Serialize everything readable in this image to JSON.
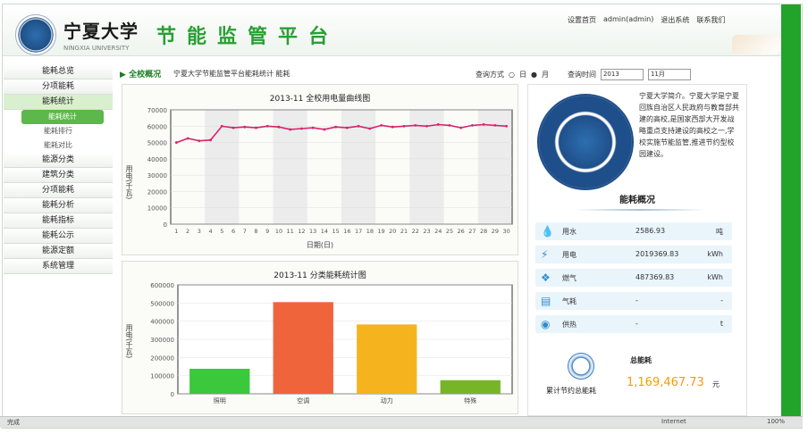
{
  "header": {
    "school_name": "宁夏大学",
    "school_sub": "NINGXIA UNIVERSITY",
    "system_title": "节能监管平台",
    "nav": [
      "设置首页",
      "admin(admin)",
      "退出系统",
      "联系我们"
    ]
  },
  "sidebar": {
    "items": [
      {
        "label": "能耗总览"
      },
      {
        "label": "分项能耗"
      },
      {
        "label": "能耗统计",
        "active": true,
        "sub": [
          {
            "label": "能耗统计",
            "active": true
          },
          {
            "label": "能耗排行"
          },
          {
            "label": "能耗对比"
          }
        ]
      },
      {
        "label": "能源分类"
      },
      {
        "label": "建筑分类"
      },
      {
        "label": "分项能耗"
      },
      {
        "label": "能耗分析"
      },
      {
        "label": "能耗指标"
      },
      {
        "label": "能耗公示"
      },
      {
        "label": "能源定额"
      },
      {
        "label": "系统管理"
      }
    ]
  },
  "breadcrumb": {
    "title": "全校概况",
    "text": "宁夏大学节能监管平台能耗统计 能耗"
  },
  "filters": {
    "label1": "查询方式",
    "opt1": "日",
    "opt2": "月",
    "label2": "查询时间",
    "year": "2013",
    "month": "11月"
  },
  "line_panel": {
    "title": "2013-11 全校用电量曲线图",
    "ylabel": "用电(千瓦)",
    "xlabel": "日期(日)"
  },
  "bar_panel": {
    "title": "2013-11 分类能耗统计图",
    "ylabel": "用电(千瓦)"
  },
  "info": {
    "emblem_text": "NINGXIA UNIVERSITY",
    "intro": "宁夏大学简介。宁夏大学是宁夏回族自治区人民政府与教育部共建的高校,是国家西部大开发战略重点支持建设的高校之一,学校实施节能监管,推进节约型校园建设。",
    "stats_title": "能耗概况",
    "stats": [
      {
        "icon": "droplet-icon",
        "glyph": "💧",
        "name": "用水",
        "value": "2586.93",
        "unit": "吨"
      },
      {
        "icon": "bolt-icon",
        "glyph": "⚡",
        "name": "用电",
        "value": "2019369.83",
        "unit": "kWh"
      },
      {
        "icon": "share-icon",
        "glyph": "❖",
        "name": "燃气",
        "value": "487369.83",
        "unit": "kWh"
      },
      {
        "icon": "flame-icon",
        "glyph": "▤",
        "name": "气耗",
        "value": "-",
        "unit": "-"
      },
      {
        "icon": "heat-icon",
        "glyph": "◉",
        "name": "供热",
        "value": "-",
        "unit": "t"
      }
    ],
    "total_label": "总能耗",
    "total_caption": "累计节约总能耗",
    "total_value": "1,169,467.73",
    "total_unit": "元"
  },
  "taskbar": {
    "left": "完成",
    "right1": "Internet",
    "zoom": "100%"
  },
  "chart_data": [
    {
      "type": "line",
      "title": "2013-11 全校用电量曲线图",
      "xlabel": "日期(日)",
      "ylabel": "用电(千瓦)",
      "x": [
        1,
        2,
        3,
        4,
        5,
        6,
        7,
        8,
        9,
        10,
        11,
        12,
        13,
        14,
        15,
        16,
        17,
        18,
        19,
        20,
        21,
        22,
        23,
        24,
        25,
        26,
        27,
        28,
        29,
        30
      ],
      "values": [
        50000,
        52500,
        51000,
        51500,
        60000,
        59000,
        59500,
        59000,
        60000,
        59500,
        58000,
        58500,
        59000,
        58000,
        59500,
        59000,
        60000,
        58500,
        60500,
        59500,
        60000,
        60500,
        60000,
        61000,
        60500,
        59000,
        60500,
        61000,
        60500,
        60000
      ],
      "ylim": [
        0,
        70000
      ],
      "color": "#d6246c"
    },
    {
      "type": "bar",
      "title": "2013-11 分类能耗统计图",
      "ylabel": "用电(千瓦)",
      "categories": [
        "照明",
        "空调",
        "动力",
        "特殊"
      ],
      "values": [
        138000,
        505000,
        382000,
        75000
      ],
      "colors": [
        "#3cc83c",
        "#f0643c",
        "#f5b41e",
        "#78b428"
      ],
      "ylim": [
        0,
        600000
      ]
    }
  ]
}
